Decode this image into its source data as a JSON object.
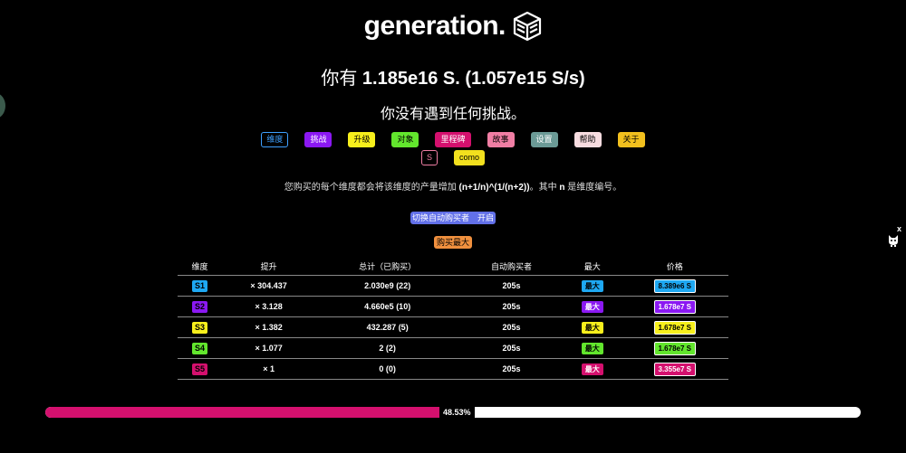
{
  "logo": {
    "text": "generation."
  },
  "score": {
    "prefix": "你有",
    "value": "1.185e16 S. (1.057e15 S/s)"
  },
  "challenge_text": "你没有遇到任何挑战。",
  "tabs_row1": [
    {
      "label": "维度",
      "bg": "#000000",
      "fg": "#3ea0ff",
      "border": "#3ea0ff"
    },
    {
      "label": "挑战",
      "bg": "#8b18f2",
      "fg": "#ffffff",
      "border": "#8b18f2"
    },
    {
      "label": "升级",
      "bg": "#f7ef1c",
      "fg": "#000000",
      "border": "#f7ef1c"
    },
    {
      "label": "对象",
      "bg": "#62e62d",
      "fg": "#000000",
      "border": "#62e62d"
    },
    {
      "label": "里程碑",
      "bg": "#d4106e",
      "fg": "#ffffff",
      "border": "#d4106e"
    },
    {
      "label": "故事",
      "bg": "#f07ea4",
      "fg": "#000000",
      "border": "#f07ea4"
    },
    {
      "label": "设置",
      "bg": "#6b9a96",
      "fg": "#ffffff",
      "border": "#6b9a96"
    },
    {
      "label": "帮助",
      "bg": "#f7dce0",
      "fg": "#000000",
      "border": "#f7dce0"
    },
    {
      "label": "关于",
      "bg": "#f2c01e",
      "fg": "#000000",
      "border": "#f2c01e"
    }
  ],
  "tabs_row2": [
    {
      "label": "S",
      "bg": "#000000",
      "fg": "#f07ea4",
      "border": "#f07ea4"
    },
    {
      "label": "como",
      "bg": "#f2e01e",
      "fg": "#000000",
      "border": "#f2e01e"
    }
  ],
  "description": {
    "pre": "您购买的每个维度都会将该维度的产量增加 ",
    "formula": "(n+1/n)^(1/(n+2))",
    "mid": "。其中 ",
    "var": "n",
    "post": " 是维度编号。"
  },
  "autobuy_toggle": "切换自动购买者　开启",
  "buy_max": "购买最大",
  "table": {
    "headers": [
      "维度",
      "提升",
      "总计（已购买）",
      "自动购买者",
      "最大",
      "价格"
    ],
    "rows": [
      {
        "dim": "S1",
        "color": "#1ea8f2",
        "boost": "× 304.437",
        "total": "2.030e9 (22)",
        "auto": "205s",
        "max": "最大",
        "price": "8.389e6 S",
        "price_fg": "#000000"
      },
      {
        "dim": "S2",
        "color": "#8b18f2",
        "boost": "× 3.128",
        "total": "4.660e5 (10)",
        "auto": "205s",
        "max": "最大",
        "price": "1.678e7 S",
        "price_fg": "#ffffff"
      },
      {
        "dim": "S3",
        "color": "#f7ef1c",
        "boost": "× 1.382",
        "total": "432.287 (5)",
        "auto": "205s",
        "max": "最大",
        "price": "1.678e7 S",
        "price_fg": "#000000"
      },
      {
        "dim": "S4",
        "color": "#62e62d",
        "boost": "× 1.077",
        "total": "2 (2)",
        "auto": "205s",
        "max": "最大",
        "price": "1.678e7 S",
        "price_fg": "#000000"
      },
      {
        "dim": "S5",
        "color": "#d4106e",
        "boost": "× 1",
        "total": "0 (0)",
        "auto": "205s",
        "max": "最大",
        "price": "3.355e7 S",
        "price_fg": "#ffffff"
      }
    ]
  },
  "progress": {
    "percent": 48.53,
    "label": "48.53%"
  },
  "side": {
    "close": "x",
    "cat_icon": "cat-icon"
  },
  "colors": {
    "background": "#000000",
    "progress": "#d4106e"
  }
}
